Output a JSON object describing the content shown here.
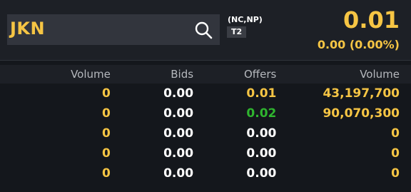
{
  "quote": {
    "symbol": "JKN",
    "flags": "(NC,NP)",
    "board": "T2",
    "last_price": "0.01",
    "change": "0.00 (0.00%)"
  },
  "order_book": {
    "headers": [
      "Volume",
      "Bids",
      "Offers",
      "Volume"
    ],
    "rows": [
      {
        "bid_volume": "0",
        "bid": "0.00",
        "offer": "0.01",
        "offer_volume": "43,197,700"
      },
      {
        "bid_volume": "0",
        "bid": "0.00",
        "offer": "0.02",
        "offer_volume": "90,070,300"
      },
      {
        "bid_volume": "0",
        "bid": "0.00",
        "offer": "0.00",
        "offer_volume": "0"
      },
      {
        "bid_volume": "0",
        "bid": "0.00",
        "offer": "0.00",
        "offer_volume": "0"
      },
      {
        "bid_volume": "0",
        "bid": "0.00",
        "offer": "0.00",
        "offer_volume": "0"
      }
    ]
  },
  "colors": {
    "accent_yellow": "#f6c544",
    "offer_green": "#2fb52f",
    "background": "#14171c"
  },
  "icons": {
    "search": "search-icon"
  }
}
